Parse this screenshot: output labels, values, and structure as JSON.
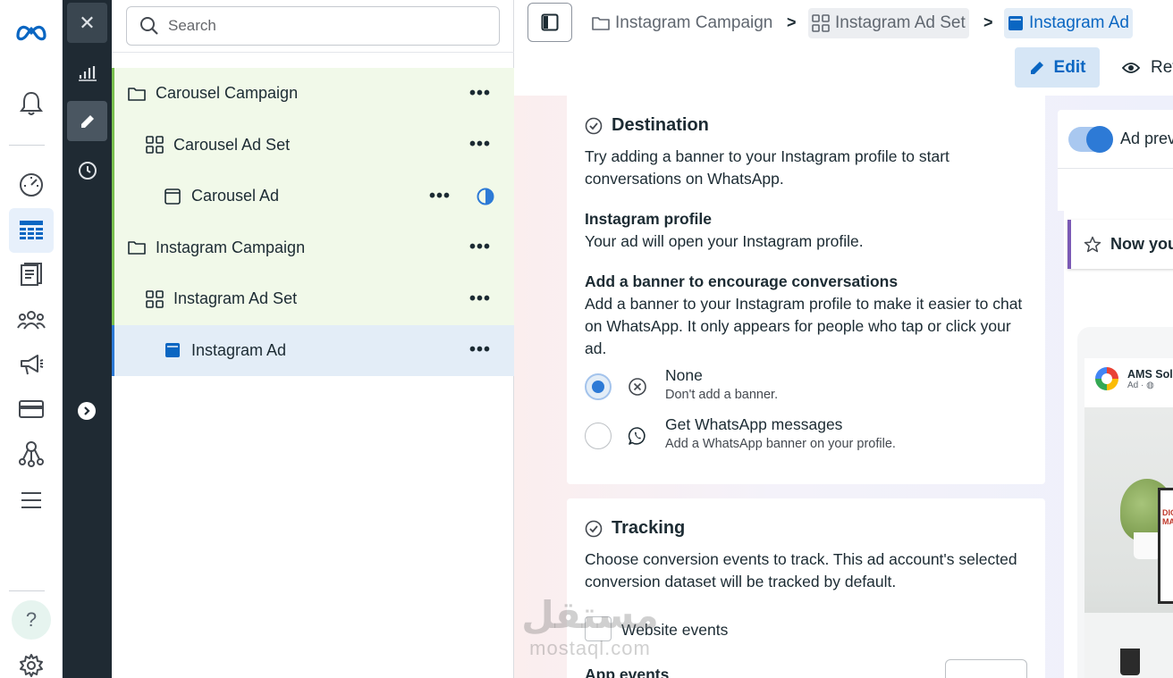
{
  "nav_rail": {
    "items": [
      {
        "name": "meta-logo-icon"
      },
      {
        "name": "notifications-bell-icon"
      },
      {
        "name": "performance-gauge-icon"
      },
      {
        "name": "ads-manager-table-icon"
      },
      {
        "name": "pages-icon"
      },
      {
        "name": "audiences-icon"
      },
      {
        "name": "campaign-megaphone-icon"
      },
      {
        "name": "billing-card-icon"
      },
      {
        "name": "business-tools-icon"
      },
      {
        "name": "menu-icon"
      },
      {
        "name": "help-icon"
      },
      {
        "name": "settings-gear-icon"
      }
    ],
    "help_glyph": "?"
  },
  "tool_column": {
    "close_glyph": "✕"
  },
  "tree": {
    "search_placeholder": "Search",
    "rows": [
      {
        "label": "Carousel Campaign",
        "level": 0,
        "type": "campaign"
      },
      {
        "label": "Carousel Ad Set",
        "level": 1,
        "type": "adset"
      },
      {
        "label": "Carousel Ad",
        "level": 2,
        "type": "ad"
      },
      {
        "label": "Instagram Campaign",
        "level": 0,
        "type": "campaign"
      },
      {
        "label": "Instagram Ad Set",
        "level": 1,
        "type": "adset"
      },
      {
        "label": "Instagram Ad",
        "level": 2,
        "type": "ad",
        "selected": true
      }
    ],
    "more_glyph": "•••"
  },
  "breadcrumb": {
    "campaign": "Instagram Campaign",
    "adset": "Instagram Ad Set",
    "ad": "Instagram Ad",
    "separator": ">"
  },
  "toolbar": {
    "edit_label": "Edit",
    "review_label": "Rev"
  },
  "destination": {
    "title": "Destination",
    "intro": "Try adding a banner to your Instagram profile to start conversations on WhatsApp.",
    "profile_heading": "Instagram profile",
    "profile_text": "Your ad will open your Instagram profile.",
    "banner_heading": "Add a banner to encourage conversations",
    "banner_text": "Add a banner to your Instagram profile to make it easier to chat on WhatsApp. It only appears for people who tap or click your ad.",
    "options": [
      {
        "title": "None",
        "subtitle": "Don't add a banner.",
        "selected": true
      },
      {
        "title": "Get WhatsApp messages",
        "subtitle": "Add a WhatsApp banner on your profile.",
        "selected": false
      }
    ]
  },
  "tracking": {
    "title": "Tracking",
    "text": "Choose conversion events to track. This ad account's selected conversion dataset will be tracked by default.",
    "website_events_label": "Website events",
    "app_events_label": "App events"
  },
  "preview": {
    "toggle_label": "Ad prev",
    "banner_text": "Now you",
    "advertiser": "AMS Solu",
    "ad_label": "Ad · ",
    "screen_text": "DIGITA\nMARKETI"
  },
  "watermark": {
    "arabic": "مستقل",
    "latin": "mostaql.com"
  },
  "colors": {
    "accent": "#0a66c2",
    "selected_row": "#e3edf7",
    "tree_highlight": "#f1f9e9",
    "tree_border": "#7ac04f",
    "dark_column": "#1f2a33"
  }
}
